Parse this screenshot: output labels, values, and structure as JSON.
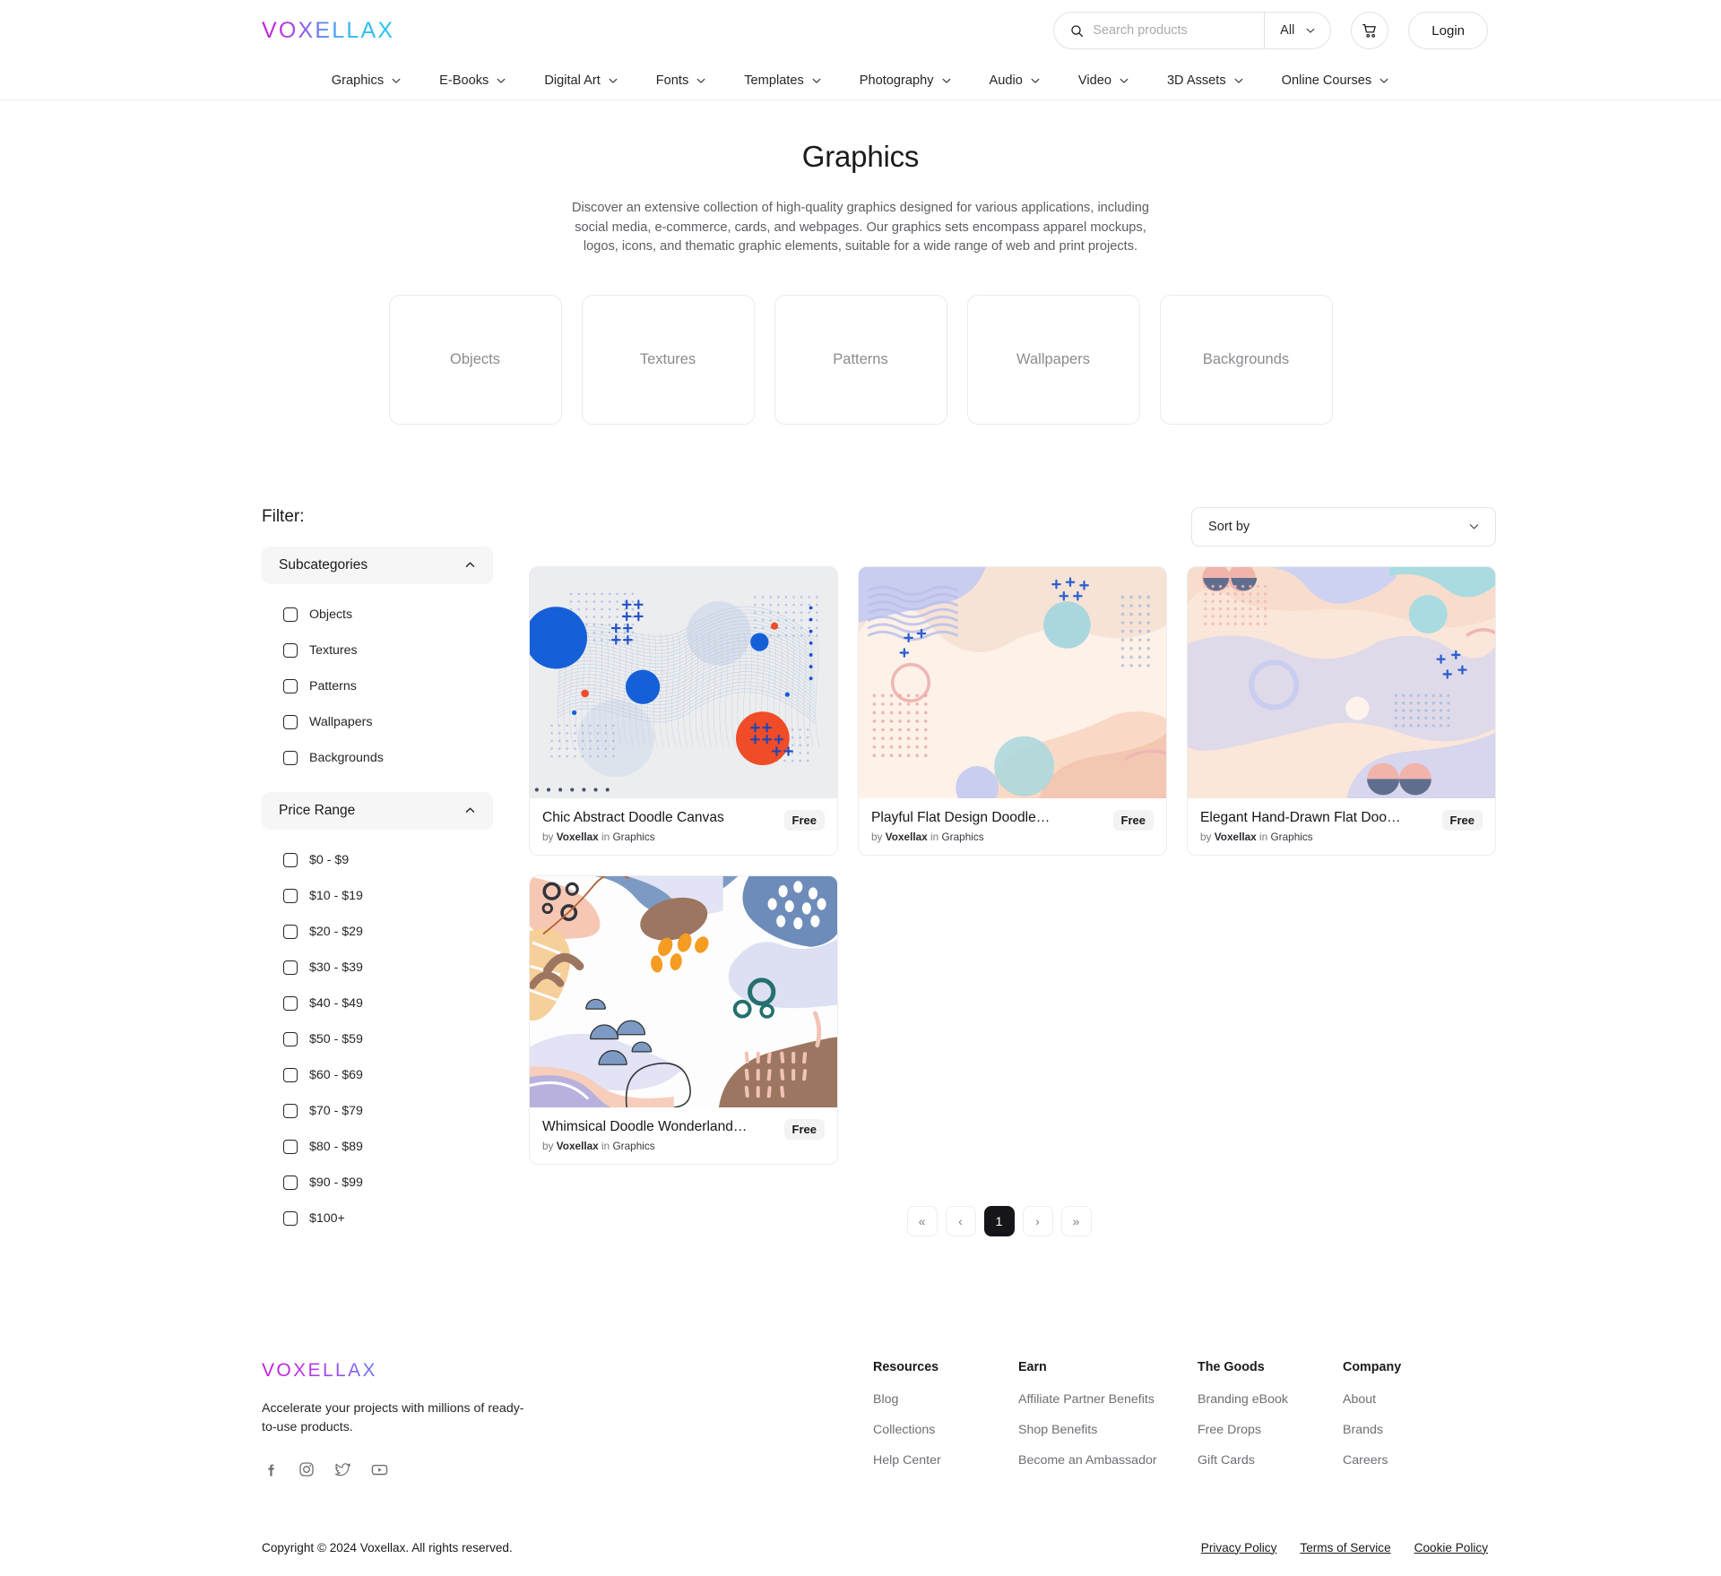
{
  "header": {
    "logo": "VOXELLAX",
    "search": {
      "placeholder": "Search products",
      "value": "",
      "scope_label": "All",
      "icon": "search-icon"
    },
    "cart_icon": "shopping-cart-icon",
    "login_label": "Login"
  },
  "nav": {
    "items": [
      {
        "label": "Graphics"
      },
      {
        "label": "E-Books"
      },
      {
        "label": "Digital Art"
      },
      {
        "label": "Fonts"
      },
      {
        "label": "Templates"
      },
      {
        "label": "Photography"
      },
      {
        "label": "Audio"
      },
      {
        "label": "Video"
      },
      {
        "label": "3D Assets"
      },
      {
        "label": "Online Courses"
      }
    ]
  },
  "hero": {
    "title": "Graphics",
    "description": "Discover an extensive collection of high-quality graphics designed for various applications, including social media, e-commerce, cards, and webpages. Our graphics sets encompass apparel mockups, logos, icons, and thematic graphic elements, suitable for a wide range of web and print projects."
  },
  "categories": [
    {
      "label": "Objects"
    },
    {
      "label": "Textures"
    },
    {
      "label": "Patterns"
    },
    {
      "label": "Wallpapers"
    },
    {
      "label": "Backgrounds"
    }
  ],
  "filter": {
    "title": "Filter:",
    "groups": [
      {
        "title": "Subcategories",
        "expanded": true,
        "options": [
          {
            "label": "Objects",
            "checked": false
          },
          {
            "label": "Textures",
            "checked": false
          },
          {
            "label": "Patterns",
            "checked": false
          },
          {
            "label": "Wallpapers",
            "checked": false
          },
          {
            "label": "Backgrounds",
            "checked": false
          }
        ]
      },
      {
        "title": "Price Range",
        "expanded": true,
        "options": [
          {
            "label": "$0 - $9",
            "checked": false
          },
          {
            "label": "$10 - $19",
            "checked": false
          },
          {
            "label": "$20 - $29",
            "checked": false
          },
          {
            "label": "$30 - $39",
            "checked": false
          },
          {
            "label": "$40 - $49",
            "checked": false
          },
          {
            "label": "$50 - $59",
            "checked": false
          },
          {
            "label": "$60 - $69",
            "checked": false
          },
          {
            "label": "$70 - $79",
            "checked": false
          },
          {
            "label": "$80 - $89",
            "checked": false
          },
          {
            "label": "$90 - $99",
            "checked": false
          },
          {
            "label": "$100+",
            "checked": false
          }
        ]
      }
    ]
  },
  "sort": {
    "selected_label": "Sort by"
  },
  "products": [
    {
      "title": "Chic Abstract Doodle Canvas",
      "by_prefix": "by",
      "author": "Voxellax",
      "in_word": "in",
      "category": "Graphics",
      "price_badge": "Free",
      "thumb": "abstract-blue-orange-mesh"
    },
    {
      "title": "Playful Flat Design Doodle…",
      "by_prefix": "by",
      "author": "Voxellax",
      "in_word": "in",
      "category": "Graphics",
      "price_badge": "Free",
      "thumb": "pastel-blob-wave"
    },
    {
      "title": "Elegant Hand-Drawn Flat Doodle…",
      "by_prefix": "by",
      "author": "Voxellax",
      "in_word": "in",
      "category": "Graphics",
      "price_badge": "Free",
      "thumb": "pastel-memphis-shapes"
    },
    {
      "title": "Whimsical Doodle Wonderland…",
      "by_prefix": "by",
      "author": "Voxellax",
      "in_word": "in",
      "category": "Graphics",
      "price_badge": "Free",
      "thumb": "organic-doodle-collage"
    }
  ],
  "pagination": {
    "first_label": "«",
    "prev_label": "‹",
    "pages": [
      {
        "label": "1",
        "active": true
      }
    ],
    "next_label": "›",
    "last_label": "»"
  },
  "footer": {
    "logo": "VOXELLAX",
    "tagline": "Accelerate your projects with millions of ready-to-use products.",
    "socials": [
      {
        "name": "facebook-icon"
      },
      {
        "name": "instagram-icon"
      },
      {
        "name": "twitter-icon"
      },
      {
        "name": "youtube-icon"
      }
    ],
    "columns": [
      {
        "heading": "Resources",
        "links": [
          {
            "label": "Blog"
          },
          {
            "label": "Collections"
          },
          {
            "label": "Help Center"
          }
        ]
      },
      {
        "heading": "Earn",
        "links": [
          {
            "label": "Affiliate Partner Benefits"
          },
          {
            "label": "Shop Benefits"
          },
          {
            "label": "Become an Ambassador"
          }
        ]
      },
      {
        "heading": "The Goods",
        "links": [
          {
            "label": "Branding eBook"
          },
          {
            "label": "Free Drops"
          },
          {
            "label": "Gift Cards"
          }
        ]
      },
      {
        "heading": "Company",
        "links": [
          {
            "label": "About"
          },
          {
            "label": "Brands"
          },
          {
            "label": "Careers"
          }
        ]
      }
    ],
    "copyright": "Copyright © 2024 Voxellax. All rights reserved.",
    "legal": [
      {
        "label": "Privacy Policy"
      },
      {
        "label": "Terms of Service"
      },
      {
        "label": "Cookie Policy"
      }
    ]
  },
  "colors": {
    "brand_start": "#c21fd6",
    "brand_end": "#29c3f5",
    "accent_dark": "#16161a",
    "muted_text": "#6e6e76",
    "card_border": "#ededee"
  }
}
